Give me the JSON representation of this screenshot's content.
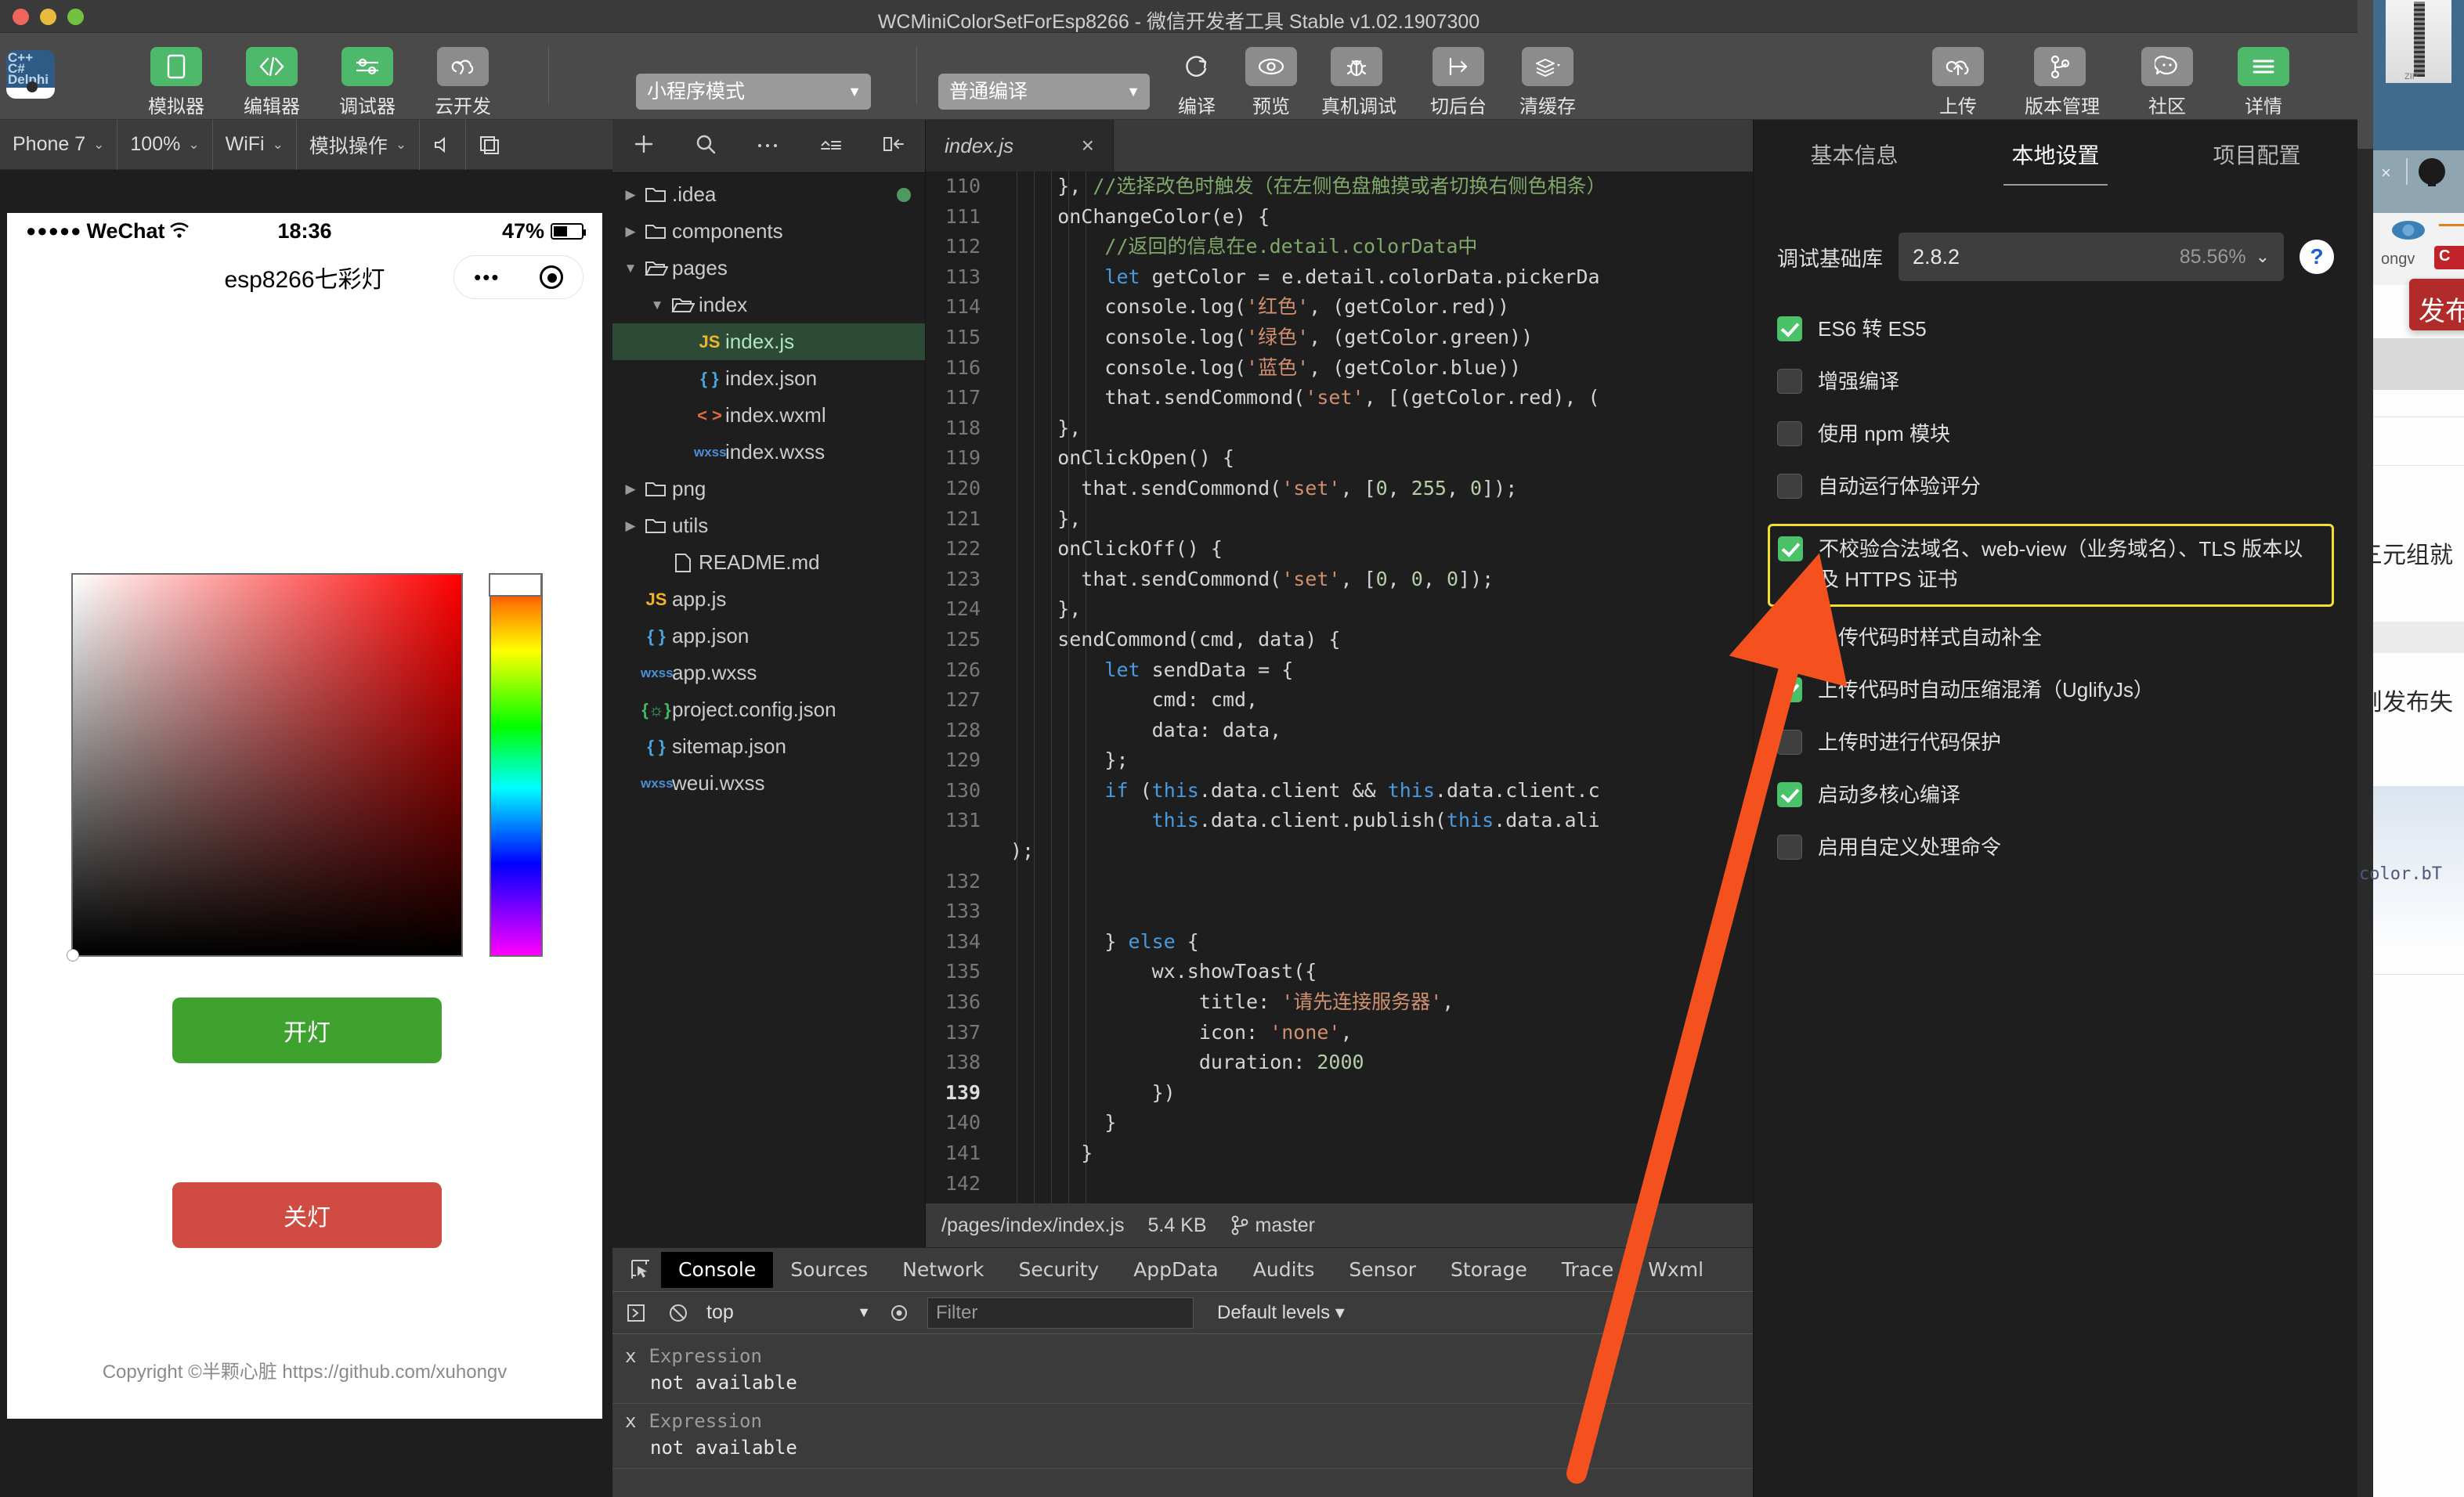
{
  "window": {
    "title": "WCMiniColorSetForEsp8266 - 微信开发者工具 Stable v1.02.1907300"
  },
  "toolbar": {
    "buttons": [
      {
        "label": "模拟器",
        "icon": "phone-icon",
        "style": "green"
      },
      {
        "label": "编辑器",
        "icon": "code-icon",
        "style": "green"
      },
      {
        "label": "调试器",
        "icon": "sliders-icon",
        "style": "green"
      },
      {
        "label": "云开发",
        "icon": "cloud-dev-icon",
        "style": "gray"
      }
    ],
    "mode_select": "小程序模式",
    "compile_select": "普通编译",
    "actions": [
      {
        "label": "编译",
        "icon": "refresh-icon"
      },
      {
        "label": "预览",
        "icon": "eye-icon"
      },
      {
        "label": "真机调试",
        "icon": "bug-icon"
      },
      {
        "label": "切后台",
        "icon": "background-icon"
      },
      {
        "label": "清缓存",
        "icon": "layers-icon"
      }
    ],
    "right_actions": [
      {
        "label": "上传",
        "icon": "upload-cloud-icon"
      },
      {
        "label": "版本管理",
        "icon": "branch-icon"
      },
      {
        "label": "社区",
        "icon": "chat-icon"
      },
      {
        "label": "详情",
        "icon": "menu-icon",
        "style": "green"
      }
    ]
  },
  "simulator": {
    "toolbar": {
      "device": "Phone 7",
      "zoom": "100%",
      "network": "WiFi",
      "mock": "模拟操作",
      "volume_icon": "speaker-icon",
      "screenshot_icon": "window-icon"
    },
    "phone": {
      "status": {
        "carrier": "WeChat",
        "signal_dots": "●●●●●",
        "wifi_icon": "wifi-icon",
        "time": "18:36",
        "battery_pct": "47%"
      },
      "nav_title": "esp8266七彩灯",
      "capsule": {
        "more": "•••",
        "target": "target-icon"
      },
      "buttons": {
        "on": "开灯",
        "off": "关灯"
      },
      "copyright": "Copyright ©半颗心脏 https://github.com/xuhongv",
      "colors": {
        "on_bg": "#3fa22e",
        "off_bg": "#d04b42"
      }
    }
  },
  "explorer": {
    "tools": [
      "plus-icon",
      "search-icon",
      "more-icon",
      "collapse-icon",
      "panel-icon"
    ],
    "files": [
      {
        "name": ".idea",
        "type": "folder",
        "indent": 0,
        "open": false,
        "badge": true
      },
      {
        "name": "components",
        "type": "folder",
        "indent": 0,
        "open": false
      },
      {
        "name": "pages",
        "type": "folder",
        "indent": 0,
        "open": true
      },
      {
        "name": "index",
        "type": "folder",
        "indent": 1,
        "open": true
      },
      {
        "name": "index.js",
        "type": "js",
        "indent": 2,
        "selected": true
      },
      {
        "name": "index.json",
        "type": "json",
        "indent": 2
      },
      {
        "name": "index.wxml",
        "type": "wxml",
        "indent": 2
      },
      {
        "name": "index.wxss",
        "type": "wxss",
        "indent": 2
      },
      {
        "name": "png",
        "type": "folder",
        "indent": 0,
        "open": false
      },
      {
        "name": "utils",
        "type": "folder",
        "indent": 0,
        "open": false
      },
      {
        "name": "README.md",
        "type": "md",
        "indent": 1
      },
      {
        "name": "app.js",
        "type": "js",
        "indent": 0
      },
      {
        "name": "app.json",
        "type": "json",
        "indent": 0
      },
      {
        "name": "app.wxss",
        "type": "wxss",
        "indent": 0
      },
      {
        "name": "project.config.json",
        "type": "cfg",
        "indent": 0
      },
      {
        "name": "sitemap.json",
        "type": "json",
        "indent": 0
      },
      {
        "name": "weui.wxss",
        "type": "wxss",
        "indent": 0
      }
    ]
  },
  "editor": {
    "tab": {
      "name": "index.js",
      "close": "×"
    },
    "first_line": 110,
    "current_line": 139,
    "lines": [
      "    }, //选择改色时触发（在左侧色盘触摸或者切换右侧色相条）",
      "    onChangeColor(e) {",
      "        //返回的信息在e.detail.colorData中",
      "        let getColor = e.detail.colorData.pickerDa",
      "        console.log('红色', (getColor.red))",
      "        console.log('绿色', (getColor.green))",
      "        console.log('蓝色', (getColor.blue))",
      "        that.sendCommond('set', [(getColor.red), (",
      "    },",
      "    onClickOpen() {",
      "      that.sendCommond('set', [0, 255, 0]);",
      "    },",
      "    onClickOff() {",
      "      that.sendCommond('set', [0, 0, 0]);",
      "    },",
      "    sendCommond(cmd, data) {",
      "        let sendData = {",
      "            cmd: cmd,",
      "            data: data,",
      "        };",
      "        if (this.data.client && this.data.client.c",
      "            this.data.client.publish(this.data.ali",
      "",
      "",
      "        } else {",
      "            wx.showToast({",
      "                title: '请先连接服务器',",
      "                icon: 'none',",
      "                duration: 2000",
      "            })",
      "        }",
      "      }",
      "",
      "})",
      ""
    ],
    "wrapped_suffix": ");",
    "status": {
      "path": "/pages/index/index.js",
      "size": "5.4 KB",
      "branch": "master",
      "branch_icon": "branch-icon"
    }
  },
  "devtools": {
    "tabs": [
      "Console",
      "Sources",
      "Network",
      "Security",
      "AppData",
      "Audits",
      "Sensor",
      "Storage",
      "Trace",
      "Wxml"
    ],
    "active_tab": "Console",
    "context": "top",
    "filter_placeholder": "Filter",
    "levels": "Default levels",
    "logs": [
      {
        "mark": "x",
        "head": "Expression",
        "body": "not available"
      },
      {
        "mark": "x",
        "head": "Expression",
        "body": "not available"
      }
    ]
  },
  "details": {
    "tabs": [
      {
        "label": "基本信息",
        "active": false
      },
      {
        "label": "本地设置",
        "active": true
      },
      {
        "label": "项目配置",
        "active": false
      }
    ],
    "library": {
      "label": "调试基础库",
      "version": "2.8.2",
      "percent": "85.56%",
      "help": "?"
    },
    "checkboxes": [
      {
        "label": "ES6 转 ES5",
        "checked": true,
        "highlight": false
      },
      {
        "label": "增强编译",
        "checked": false,
        "highlight": false
      },
      {
        "label": "使用 npm 模块",
        "checked": false,
        "highlight": false
      },
      {
        "label": "自动运行体验评分",
        "checked": false,
        "highlight": false
      },
      {
        "label": "不校验合法域名、web-view（业务域名）、TLS 版本以及 HTTPS 证书",
        "checked": true,
        "highlight": true
      },
      {
        "label": "上传代码时样式自动补全",
        "checked": true,
        "highlight": false
      },
      {
        "label": "上传代码时自动压缩混淆（UglifyJs）",
        "checked": true,
        "highlight": false
      },
      {
        "label": "上传时进行代码保护",
        "checked": false,
        "highlight": false
      },
      {
        "label": "启动多核心编译",
        "checked": true,
        "highlight": false
      },
      {
        "label": "启用自定义处理命令",
        "checked": false,
        "highlight": false
      }
    ]
  },
  "annotation": {
    "arrow_color": "#f4511e",
    "highlight_color": "#f4e02c"
  },
  "background_windows": {
    "zip_label": "ZIP",
    "user": "ongv",
    "publish_button": "发布",
    "text_line_1": "三元组就",
    "text_line_2": "则发布失",
    "code_snippet": "color.bT"
  }
}
